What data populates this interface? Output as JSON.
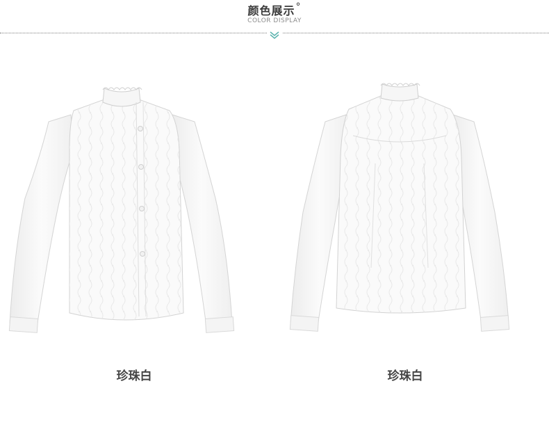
{
  "header": {
    "title": "颜色展示",
    "title_mark": "°",
    "subtitle": "COLOR DISPLAY"
  },
  "colors": {
    "accent": "#5bb3ae",
    "text": "#3a3a3a"
  },
  "products": [
    {
      "view": "front",
      "caption": "珍珠白"
    },
    {
      "view": "back",
      "caption": "珍珠白"
    }
  ]
}
